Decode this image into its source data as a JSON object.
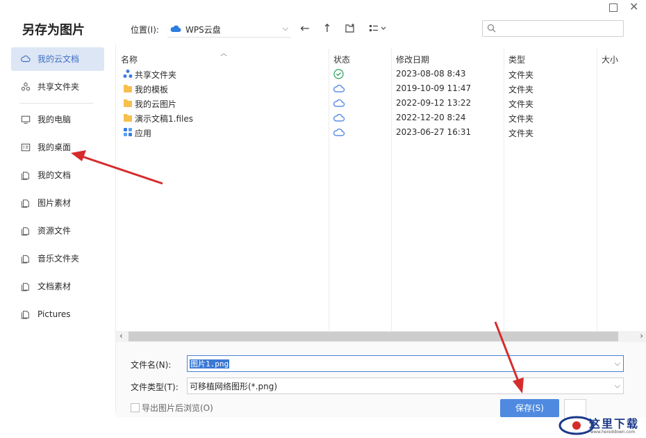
{
  "dialog": {
    "title": "另存为图片"
  },
  "sidebar": {
    "items": [
      {
        "label": "我的云文档",
        "icon": "cloud-icon",
        "active": true
      },
      {
        "label": "共享文件夹",
        "icon": "share-icon",
        "active": false
      },
      {
        "label": "我的电脑",
        "icon": "computer-icon",
        "active": false
      },
      {
        "label": "我的桌面",
        "icon": "desktop-icon",
        "active": false
      },
      {
        "label": "我的文档",
        "icon": "folder-icon",
        "active": false
      },
      {
        "label": "图片素材",
        "icon": "folder-icon",
        "active": false
      },
      {
        "label": "资源文件",
        "icon": "folder-icon",
        "active": false
      },
      {
        "label": "音乐文件夹",
        "icon": "folder-icon",
        "active": false
      },
      {
        "label": "文档素材",
        "icon": "folder-icon",
        "active": false
      },
      {
        "label": "Pictures",
        "icon": "folder-icon",
        "active": false
      }
    ]
  },
  "toolbar": {
    "location_label": "位置(I):",
    "location_value": "WPS云盘",
    "search_placeholder": ""
  },
  "file_list": {
    "columns": [
      "名称",
      "状态",
      "修改日期",
      "类型",
      "大小"
    ],
    "rows": [
      {
        "name": "共享文件夹",
        "icon": "shared-folder-icon",
        "status": "synced-check-icon",
        "date": "2023-08-08 8:43",
        "type": "文件夹"
      },
      {
        "name": "我的模板",
        "icon": "folder-icon",
        "status": "cloud-icon",
        "date": "2019-10-09 11:47",
        "type": "文件夹"
      },
      {
        "name": "我的云图片",
        "icon": "folder-icon",
        "status": "cloud-icon",
        "date": "2022-09-12 13:22",
        "type": "文件夹"
      },
      {
        "name": "演示文稿1.files",
        "icon": "folder-icon",
        "status": "cloud-icon",
        "date": "2022-12-20 8:24",
        "type": "文件夹"
      },
      {
        "name": "应用",
        "icon": "apps-icon",
        "status": "cloud-icon",
        "date": "2023-06-27 16:31",
        "type": "文件夹"
      }
    ]
  },
  "form": {
    "filename_label": "文件名(N):",
    "filename_value": "图片1.png",
    "filetype_label": "文件类型(T):",
    "filetype_value": "可移植网络图形(*.png)",
    "open_after_label": "导出图片后浏览(O)",
    "save_label": "保存(S)"
  },
  "watermark": {
    "text": "这里下载",
    "url": "www.hereddown.com"
  },
  "colors": {
    "accent": "#4f8ae0",
    "sidebar_active_bg": "#dde6f4",
    "arrow": "#d62b2b"
  }
}
